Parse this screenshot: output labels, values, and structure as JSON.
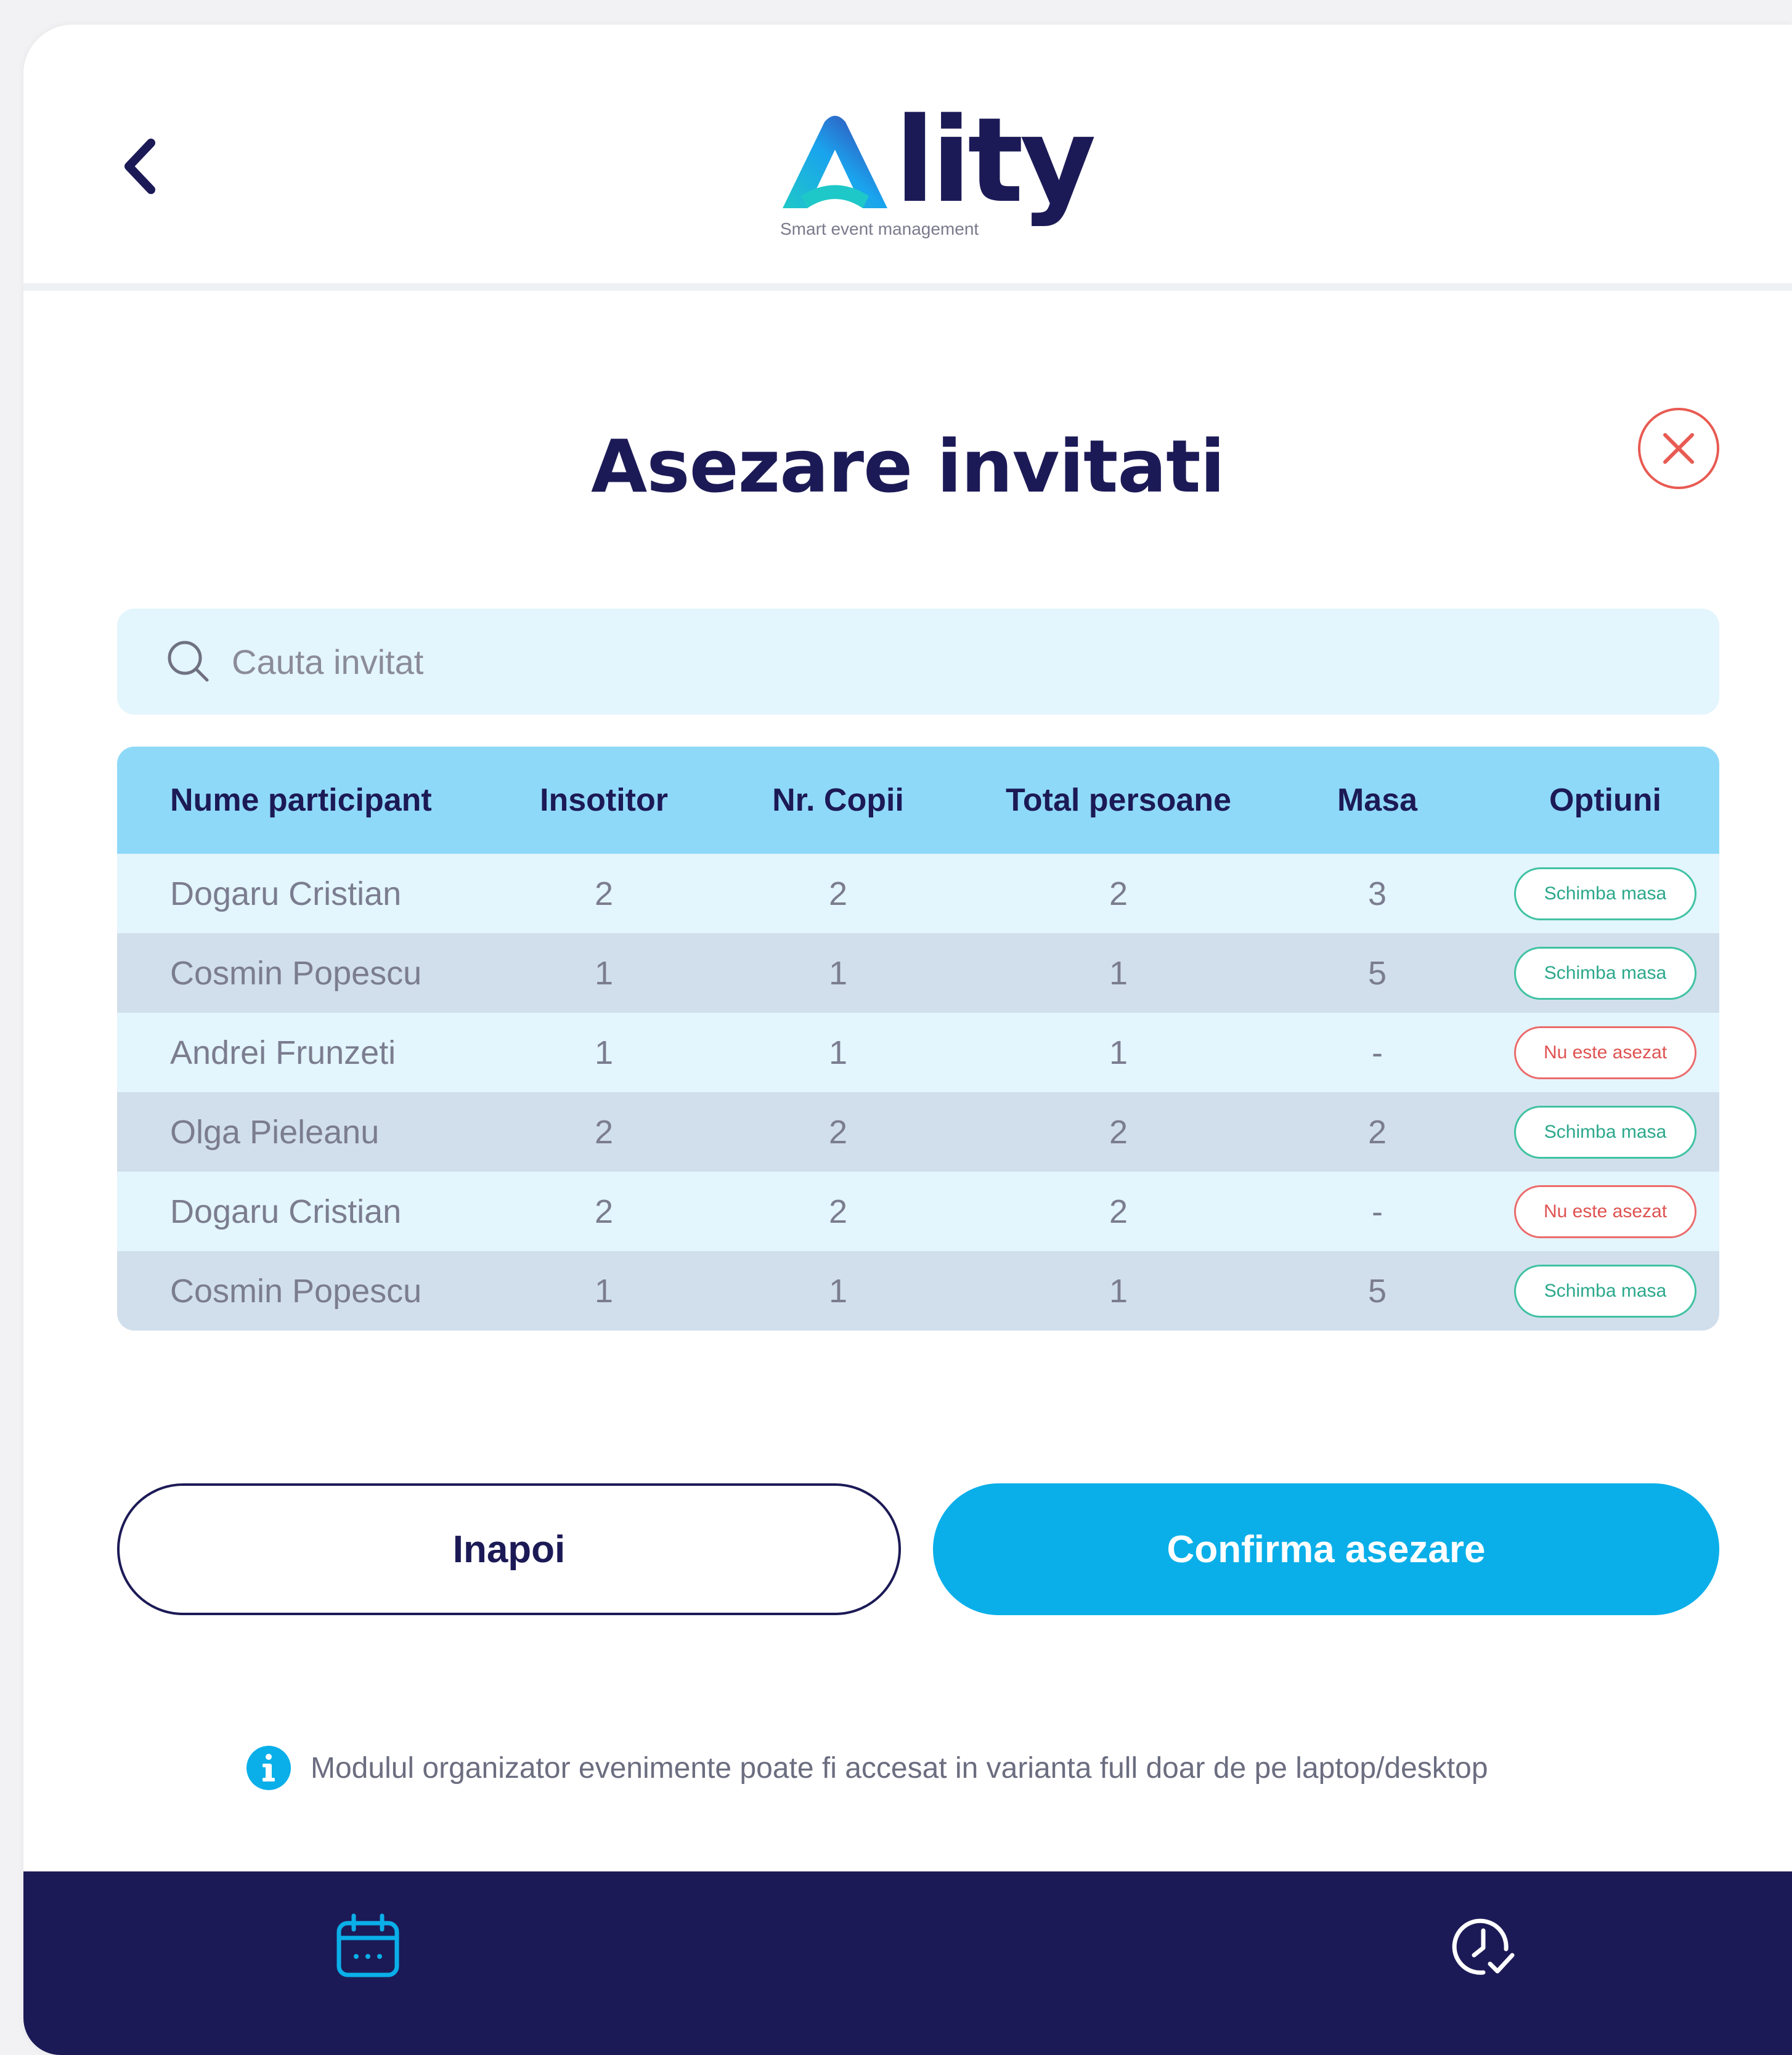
{
  "header": {
    "logo_text": "lity",
    "logo_tagline": "Smart event management"
  },
  "page": {
    "title": "Asezare invitati"
  },
  "search": {
    "placeholder": "Cauta invitat"
  },
  "table": {
    "columns": [
      "Nume participant",
      "Insotitor",
      "Nr. Copii",
      "Total persoane",
      "Masa",
      "Optiuni"
    ],
    "rows": [
      {
        "name": "Dogaru Cristian",
        "insotitor": "2",
        "copii": "2",
        "total": "2",
        "masa": "3",
        "option": "Schimba masa",
        "status": "seated"
      },
      {
        "name": "Cosmin Popescu",
        "insotitor": "1",
        "copii": "1",
        "total": "1",
        "masa": "5",
        "option": "Schimba masa",
        "status": "seated"
      },
      {
        "name": "Andrei Frunzeti",
        "insotitor": "1",
        "copii": "1",
        "total": "1",
        "masa": "-",
        "option": "Nu este asezat",
        "status": "unseated"
      },
      {
        "name": "Olga Pieleanu",
        "insotitor": "2",
        "copii": "2",
        "total": "2",
        "masa": "2",
        "option": "Schimba masa",
        "status": "seated"
      },
      {
        "name": "Dogaru Cristian",
        "insotitor": "2",
        "copii": "2",
        "total": "2",
        "masa": "-",
        "option": "Nu este asezat",
        "status": "unseated"
      },
      {
        "name": "Cosmin Popescu",
        "insotitor": "1",
        "copii": "1",
        "total": "1",
        "masa": "5",
        "option": "Schimba masa",
        "status": "seated"
      }
    ]
  },
  "actions": {
    "back_label": "Inapoi",
    "confirm_label": "Confirma asezare"
  },
  "info": {
    "text": "Modulul organizator evenimente poate fi accesat in varianta full doar de pe laptop/desktop"
  },
  "icons": {
    "back": "chevron-left-icon",
    "close": "close-icon",
    "search": "search-icon",
    "info": "info-icon",
    "calendar": "calendar-icon",
    "history": "clock-check-icon"
  },
  "colors": {
    "brand_dark": "#1c1a56",
    "accent": "#0aafe9",
    "header_row": "#8fd9f8",
    "row_light": "#e3f5fd",
    "row_dark": "#d1dfec",
    "success": "#3fc2a2",
    "danger": "#e85a52"
  }
}
